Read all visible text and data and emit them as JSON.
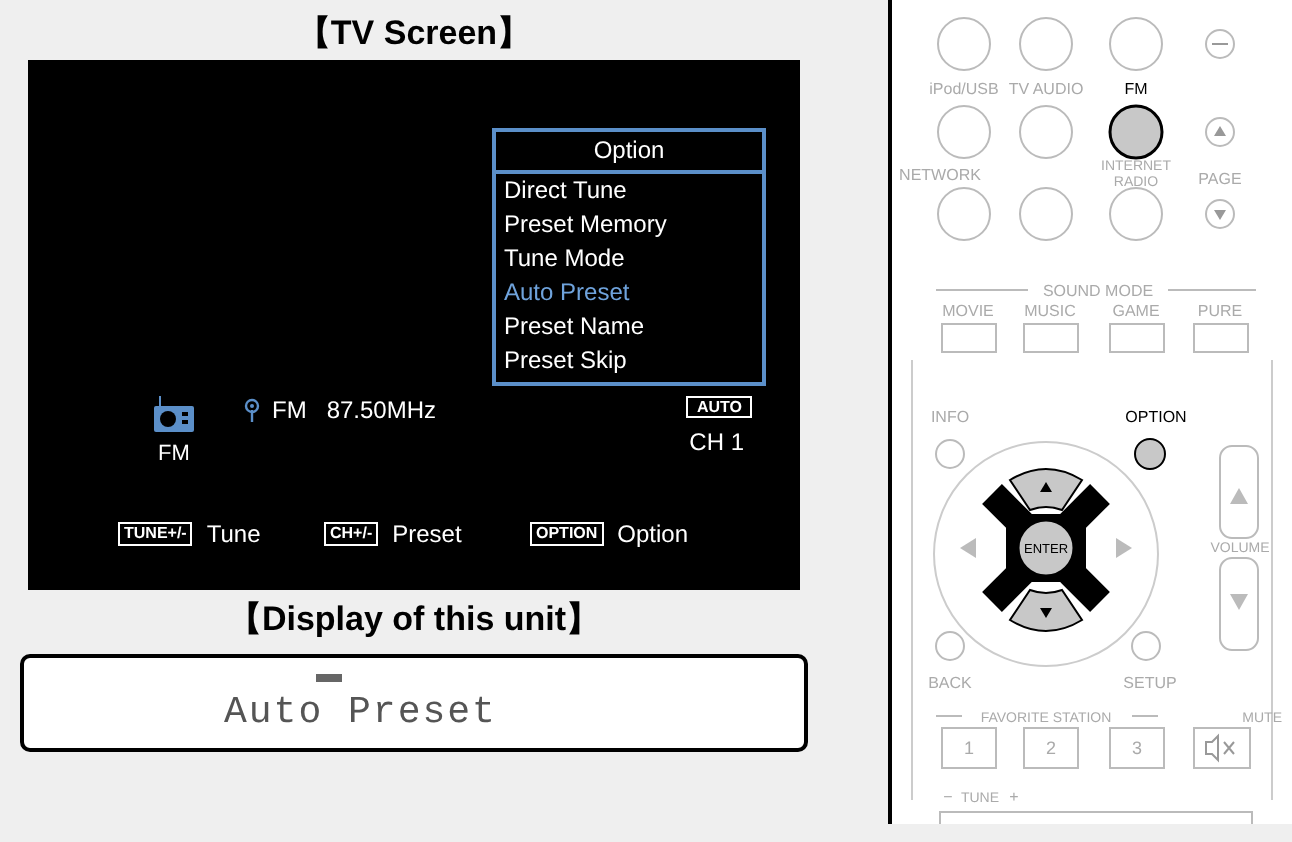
{
  "tv_screen": {
    "heading": "【TV Screen】",
    "menu": {
      "title": "Option",
      "items": [
        {
          "label": "Direct Tune",
          "selected": false
        },
        {
          "label": "Preset Memory",
          "selected": false
        },
        {
          "label": "Tune Mode",
          "selected": false
        },
        {
          "label": "Auto Preset",
          "selected": true
        },
        {
          "label": "Preset Name",
          "selected": false
        },
        {
          "label": "Preset Skip",
          "selected": false
        }
      ]
    },
    "source": "FM",
    "band": "FM",
    "frequency": "87.50MHz",
    "mode_badge": "AUTO",
    "channel": "CH 1",
    "hints": [
      {
        "key": "TUNE+/-",
        "label": "Tune"
      },
      {
        "key": "CH+/-",
        "label": "Preset"
      },
      {
        "key": "OPTION",
        "label": "Option"
      }
    ]
  },
  "unit_display": {
    "heading": "【Display of this unit】",
    "text": "Auto Preset"
  },
  "remote": {
    "source_buttons": [
      {
        "label": "iPod/USB",
        "pressed": false
      },
      {
        "label": "TV AUDIO",
        "pressed": false
      },
      {
        "label": "FM",
        "pressed": true
      },
      {
        "label": "NETWORK",
        "pressed": false
      },
      {
        "pressed": false
      },
      {
        "label": "INTERNET RADIO",
        "pressed": false
      }
    ],
    "page_label": "PAGE",
    "sound_mode_label": "SOUND MODE",
    "sound_modes": [
      "MOVIE",
      "MUSIC",
      "GAME",
      "PURE"
    ],
    "info": {
      "label": "INFO",
      "pressed": false
    },
    "option": {
      "label": "OPTION",
      "pressed": true
    },
    "enter": {
      "label": "ENTER",
      "pressed": true
    },
    "up_pressed": true,
    "down_pressed": true,
    "volume_label": "VOLUME",
    "back": {
      "label": "BACK",
      "pressed": false
    },
    "setup": {
      "label": "SETUP",
      "pressed": false
    },
    "favorite_label": "FAVORITE STATION",
    "mute_label": "MUTE",
    "favorites": [
      "1",
      "2",
      "3"
    ],
    "tune_minus": "−",
    "tune_label": "TUNE",
    "tune_plus": "+"
  }
}
